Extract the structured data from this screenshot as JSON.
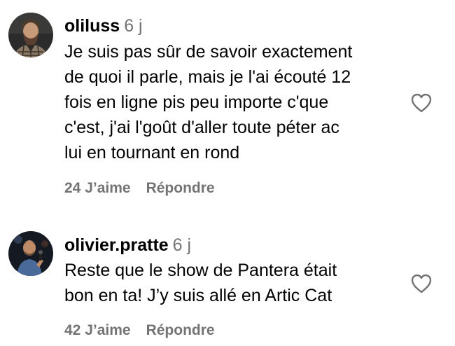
{
  "comments": [
    {
      "username": "oliluss",
      "time": "6 j",
      "text": "Je suis pas sûr de savoir exactement\nde quoi il parle, mais je l'ai écouté 12\nfois en ligne pis peu importe c'que\nc'est, j'ai l'goût d'aller toute péter ac\nlui en tournant en rond",
      "likes_label": "24 J’aime",
      "reply_label": "Répondre",
      "avatar_icon": "bearded-man-avatar",
      "like_icon": "heart-outline-icon"
    },
    {
      "username": "olivier.pratte",
      "time": "6 j",
      "text": "Reste que le show de Pantera était\nbon en ta! J’y suis allé en Artic Cat",
      "likes_label": "42 J’aime",
      "reply_label": "Répondre",
      "avatar_icon": "man-with-microphone-avatar",
      "like_icon": "heart-outline-icon"
    }
  ],
  "colors": {
    "secondary_text": "#737373",
    "primary_text": "#000000",
    "background": "#ffffff"
  }
}
